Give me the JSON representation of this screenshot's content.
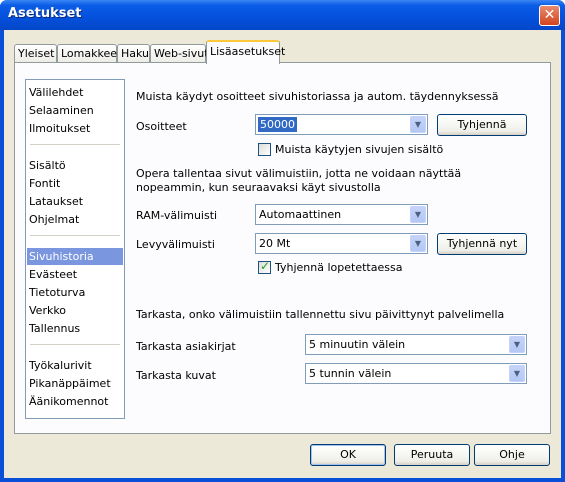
{
  "window": {
    "title": "Asetukset",
    "close_glyph": "✕"
  },
  "tabs": [
    {
      "label": "Yleiset"
    },
    {
      "label": "Lomakkeet"
    },
    {
      "label": "Haku"
    },
    {
      "label": "Web-sivut"
    },
    {
      "label": "Lisäasetukset",
      "active": true
    }
  ],
  "sidebar": {
    "groups": [
      [
        "Välilehdet",
        "Selaaminen",
        "Ilmoitukset"
      ],
      [
        "Sisältö",
        "Fontit",
        "Lataukset",
        "Ohjelmat"
      ],
      [
        "Sivuhistoria",
        "Evästeet",
        "Tietoturva",
        "Verkko",
        "Tallennus"
      ],
      [
        "Työkalurivit",
        "Pikanäppäimet",
        "Äänikomennot"
      ]
    ],
    "selected": "Sivuhistoria"
  },
  "history": {
    "heading": "Muista käydyt osoitteet sivuhistoriassa ja autom. täydennyksessä",
    "addresses_label": "Osoitteet",
    "addresses_value": "50000",
    "clear_button": "Tyhjennä",
    "remember_content_label": "Muista käytyjen sivujen sisältö",
    "remember_content_checked": false
  },
  "cache": {
    "description_line1": "Opera tallentaa sivut välimuistiin, jotta ne voidaan näyttää",
    "description_line2": "nopeammin, kun seuraavaksi käyt sivustolla",
    "ram_label": "RAM-välimuisti",
    "ram_value": "Automaattinen",
    "disk_label": "Levyvälimuisti",
    "disk_value": "20 Mt",
    "clear_now_button": "Tyhjennä nyt",
    "clear_on_exit_label": "Tyhjennä lopetettaessa",
    "clear_on_exit_checked": true
  },
  "check": {
    "heading": "Tarkasta, onko välimuistiin tallennettu sivu päivittynyt palvelimella",
    "documents_label": "Tarkasta asiakirjat",
    "documents_value": "5 minuutin välein",
    "images_label": "Tarkasta kuvat",
    "images_value": "5 tunnin välein"
  },
  "footer": {
    "ok": "OK",
    "cancel": "Peruuta",
    "help": "Ohje"
  },
  "icons": {
    "dropdown": "chevron-down-icon",
    "check": "checkmark-icon"
  }
}
